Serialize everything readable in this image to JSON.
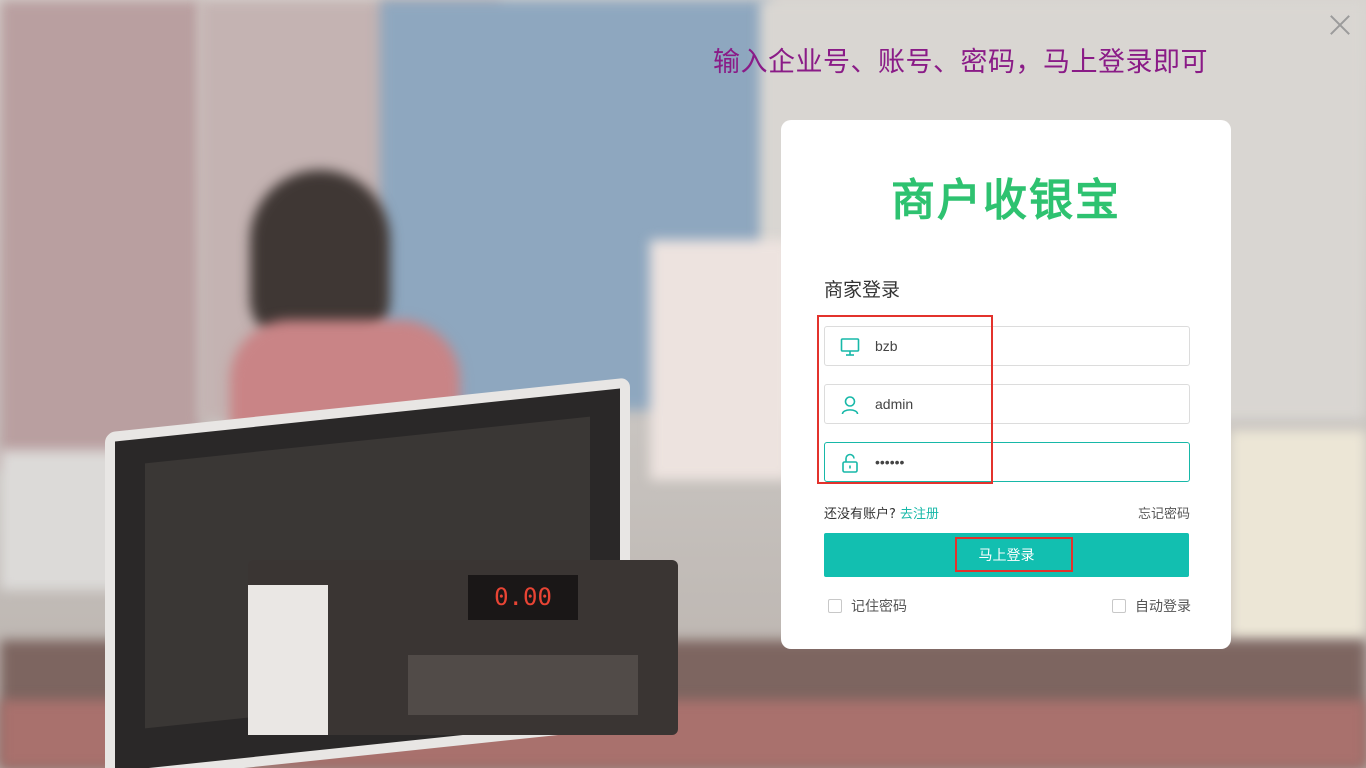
{
  "banner_text": "输入企业号、账号、密码，马上登录即可",
  "background": {
    "register_display": "0.00"
  },
  "login_card": {
    "logo": "商户收银宝",
    "title": "商家登录",
    "company_field": {
      "value": "bzb",
      "icon": "monitor-icon"
    },
    "account_field": {
      "value": "admin",
      "icon": "user-icon"
    },
    "password_field": {
      "value": "••••••",
      "icon": "lock-open-icon"
    },
    "no_account_text": "还没有账户?",
    "register_link": "去注册",
    "forgot_password": "忘记密码",
    "login_button": "马上登录",
    "remember_password": "记住密码",
    "auto_login": "自动登录"
  },
  "colors": {
    "accent": "#12bfb0",
    "logo_green": "#2ec270",
    "banner_purple": "#8a1b87",
    "highlight_red": "#e3322c"
  }
}
